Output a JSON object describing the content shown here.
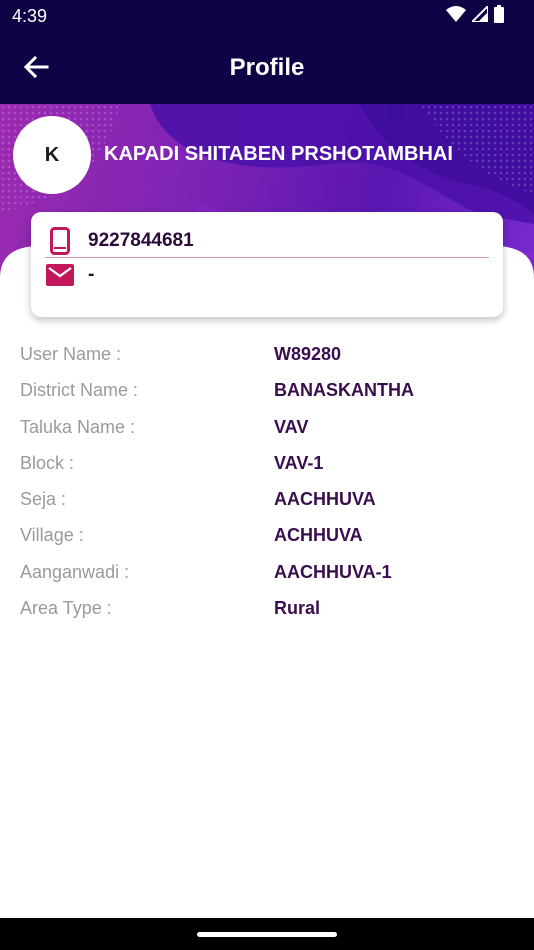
{
  "status_bar": {
    "time": "4:39"
  },
  "app_bar": {
    "title": "Profile"
  },
  "profile": {
    "avatar_initial": "K",
    "name": "KAPADI SHITABEN PRSHOTAMBHAI",
    "phone": "9227844681",
    "email": "-"
  },
  "details": [
    {
      "label": "User Name :",
      "value": "W89280"
    },
    {
      "label": "District Name :",
      "value": "BANASKANTHA"
    },
    {
      "label": "Taluka Name :",
      "value": "VAV"
    },
    {
      "label": "Block :",
      "value": "VAV-1"
    },
    {
      "label": "Seja :",
      "value": "AACHHUVA"
    },
    {
      "label": "Village :",
      "value": "ACHHUVA"
    },
    {
      "label": "Aanganwadi :",
      "value": "AACHHUVA-1"
    },
    {
      "label": "Area Type :",
      "value": "Rural"
    }
  ],
  "colors": {
    "header": "#0e0345",
    "accent": "#c2185b",
    "label": "#9a9a9a",
    "value": "#3a0d4e"
  },
  "icons": {
    "back": "arrow-left-icon",
    "phone": "smartphone-icon",
    "email": "mail-icon",
    "wifi": "wifi-icon",
    "signal": "signal-icon",
    "battery": "battery-icon"
  }
}
